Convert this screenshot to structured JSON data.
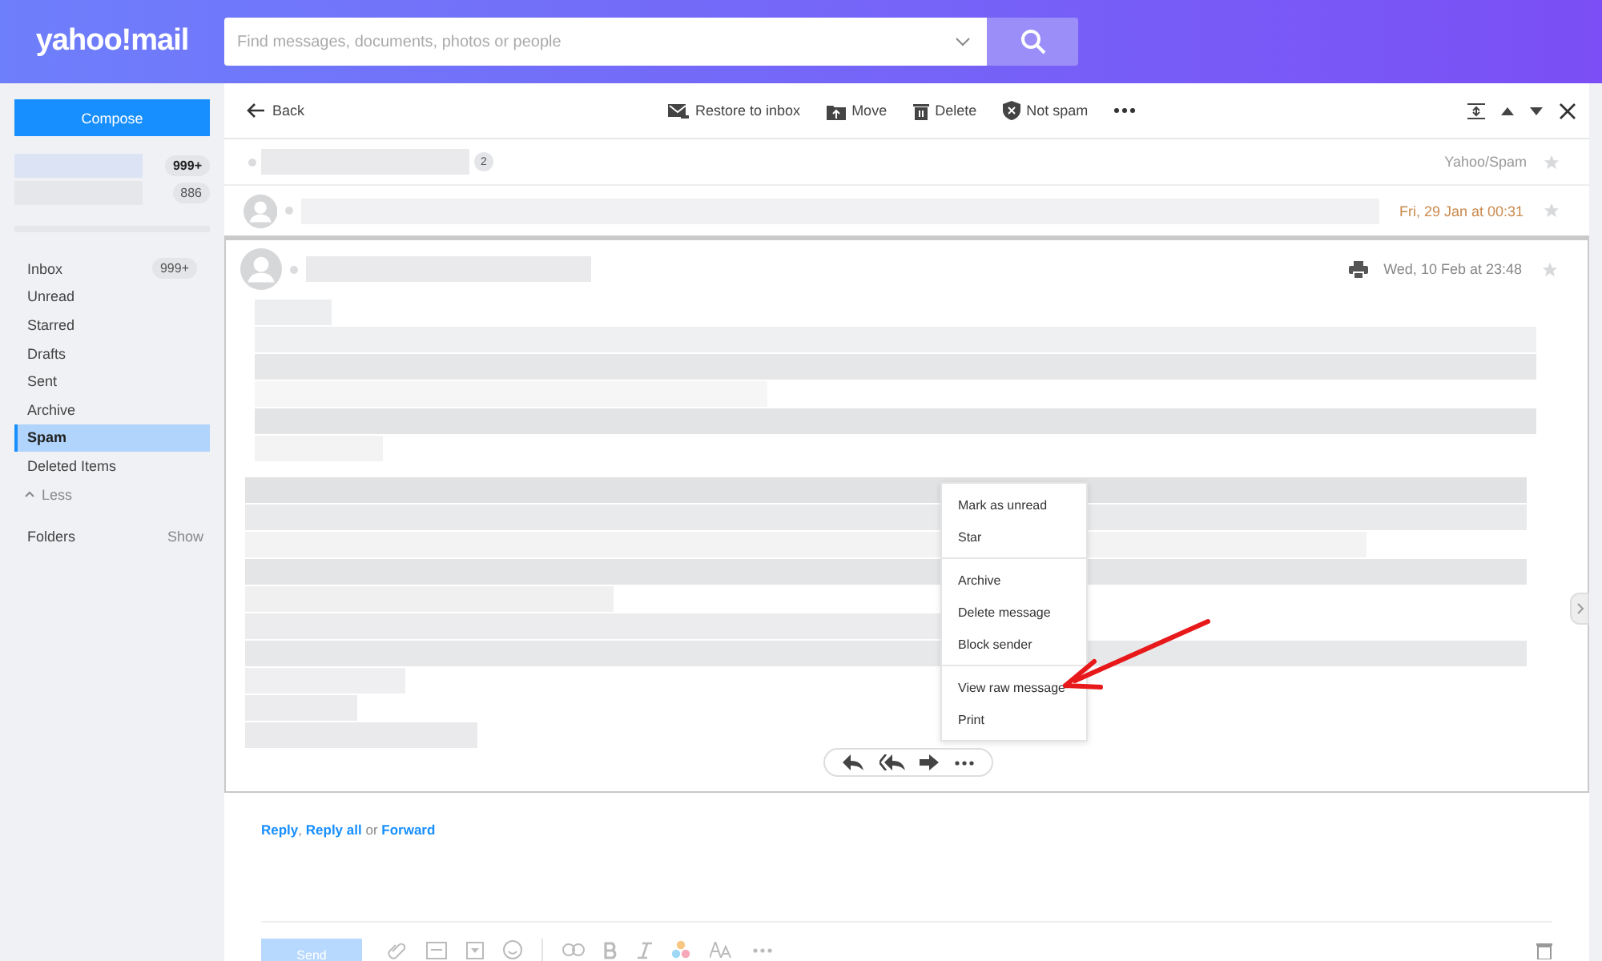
{
  "header": {
    "logo": "yahoo!mail",
    "search": {
      "placeholder": "Find messages, documents, photos or people"
    }
  },
  "sidebar": {
    "compose": "Compose",
    "accounts": [
      {
        "count": "999+",
        "selected": true
      },
      {
        "count": "886",
        "selected": false
      }
    ],
    "folders": [
      {
        "label": "Inbox",
        "count": "999+",
        "selected": false
      },
      {
        "label": "Unread",
        "selected": false
      },
      {
        "label": "Starred",
        "selected": false
      },
      {
        "label": "Drafts",
        "selected": false
      },
      {
        "label": "Sent",
        "selected": false
      },
      {
        "label": "Archive",
        "selected": false
      },
      {
        "label": "Spam",
        "selected": true
      },
      {
        "label": "Deleted Items",
        "selected": false
      }
    ],
    "less": "Less",
    "folders_heading": "Folders",
    "show": "Show"
  },
  "toolbar": {
    "back": "Back",
    "actions": [
      {
        "kind": "restore",
        "label": "Restore to inbox"
      },
      {
        "kind": "move",
        "label": "Move"
      },
      {
        "kind": "delete",
        "label": "Delete"
      },
      {
        "kind": "notspam",
        "label": "Not spam"
      }
    ]
  },
  "thread": {
    "count": "2",
    "folder": "Yahoo/Spam",
    "messages": [
      {
        "date": "Fri, 29 Jan at 00:31",
        "expanded": false
      },
      {
        "date": "Wed, 10 Feb at 23:48",
        "expanded": true
      }
    ]
  },
  "menu": {
    "groups": [
      [
        "Mark as unread",
        "Star"
      ],
      [
        "Archive",
        "Delete message",
        "Block sender"
      ],
      [
        "View raw message",
        "Print"
      ]
    ]
  },
  "reply_prompt": [
    {
      "kind": "link",
      "text": "Reply"
    },
    {
      "kind": "text",
      "text": ", "
    },
    {
      "kind": "link",
      "text": "Reply all"
    },
    {
      "kind": "text",
      "text": " or "
    },
    {
      "kind": "link",
      "text": "Forward"
    }
  ],
  "composer": {
    "send": "Send",
    "send_disabled": true
  }
}
